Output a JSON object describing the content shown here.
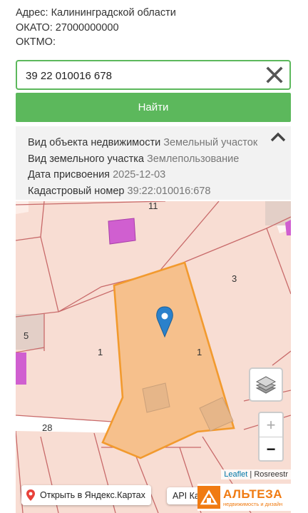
{
  "top_info": {
    "address": "Адрес: Калининградской области",
    "okato": "ОКАТО: 27000000000",
    "oktmo": "ОКТМО:"
  },
  "search": {
    "value": "39 22 010016 678",
    "find_label": "Найти"
  },
  "info": {
    "rows": [
      {
        "key": "Вид объекта недвижимости",
        "value": "Земельный участок"
      },
      {
        "key": "Вид земельного участка",
        "value": "Землепользование"
      },
      {
        "key": "Дата присвоения",
        "value": "2025-12-03"
      },
      {
        "key": "Кадастровый номер",
        "value": "39:22:010016:678"
      }
    ]
  },
  "map": {
    "labels": {
      "l11": "11",
      "l3": "3",
      "l5": "5",
      "l1_left": "1",
      "l1_right": "1",
      "l28": "28"
    },
    "zoom_in": "+",
    "zoom_out": "−",
    "attribution_leaflet": "Leaflet",
    "attribution_sep": " | ",
    "attribution_src": "Rosreestr",
    "yandex_button": "Открыть в Яндекс.Картах",
    "api_link": "API Ка",
    "icons": {
      "marker": "map-marker-icon",
      "layers": "layers-icon",
      "pin": "location-pin-icon"
    },
    "colors": {
      "selected_fill": "#f6c08c",
      "selected_stroke": "#f29a2e",
      "parcel_line": "#c86a6a",
      "marker": "#2a81cb",
      "building": "#d05fd0"
    }
  },
  "watermark": {
    "name": "АЛЬТЕЗА",
    "tagline": "недвижимость и дизайн"
  }
}
